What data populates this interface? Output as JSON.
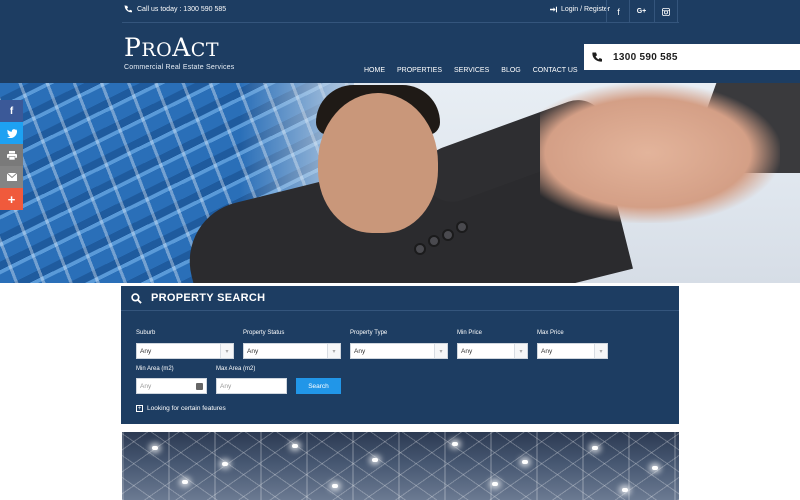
{
  "topbar": {
    "call_text": "Call us today : 1300 590 585",
    "login_text": "Login / Register",
    "social": {
      "facebook": "f",
      "googleplus": "G+",
      "instagram": "instagram-icon"
    }
  },
  "logo": {
    "first": "P",
    "rest": "RO",
    "second": "A",
    "rest2": "CT",
    "tagline": "Commercial Real Estate Services"
  },
  "nav": [
    "HOME",
    "PROPERTIES",
    "SERVICES",
    "BLOG",
    "CONTACT US"
  ],
  "phone_box": {
    "number": "1300 590 585"
  },
  "share": {
    "facebook": "f",
    "twitter": "twitter-icon",
    "print": "print-icon",
    "mail": "mail-icon",
    "more": "+"
  },
  "search": {
    "title": "PROPERTY SEARCH",
    "fields": {
      "suburb": {
        "label": "Suburb",
        "value": "Any"
      },
      "status": {
        "label": "Property Status",
        "value": "Any"
      },
      "type": {
        "label": "Property Type",
        "value": "Any"
      },
      "min_price": {
        "label": "Min Price",
        "value": "Any"
      },
      "max_price": {
        "label": "Max Price",
        "value": "Any"
      },
      "min_area": {
        "label": "Min Area (m2)",
        "placeholder": "Any"
      },
      "max_area": {
        "label": "Max Area (m2)",
        "placeholder": "Any"
      }
    },
    "button": "Search",
    "features_link": "Looking for certain features"
  },
  "colors": {
    "navy": "#1d3d62",
    "accent_blue": "#2196e8",
    "facebook": "#3b5998",
    "twitter": "#1da1f2",
    "more": "#f05a3c"
  }
}
